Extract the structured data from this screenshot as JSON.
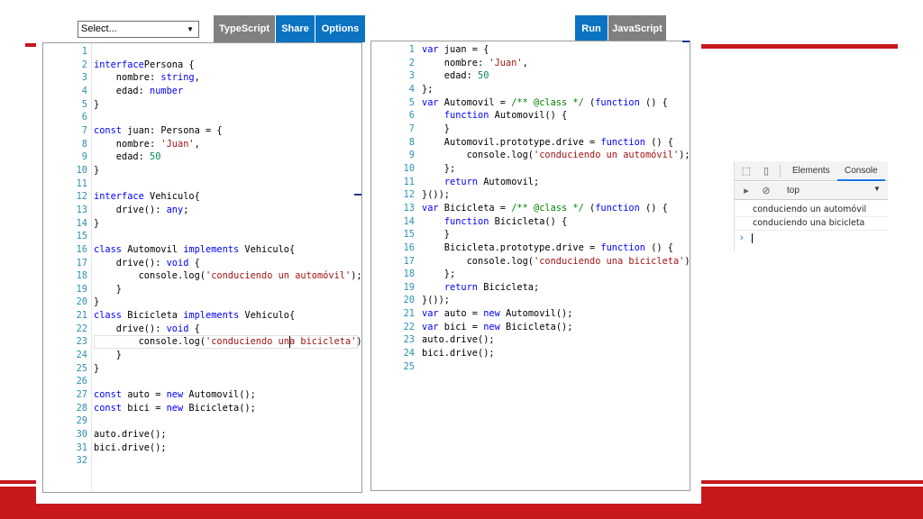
{
  "toolbar": {
    "select_value": "Select...",
    "typescript_label": "TypeScript",
    "share_label": "Share",
    "options_label": "Options",
    "run_label": "Run",
    "javascript_label": "JavaScript"
  },
  "colors": {
    "keyword": "#0000ff",
    "string": "#a31515",
    "number": "#09885a",
    "comment": "#008000",
    "line_number": "#2b91af",
    "accent_blue": "#0b73c2",
    "slide_red": "#c8171d"
  },
  "ts_code": [
    [],
    [
      [
        "kw",
        "interface"
      ],
      [
        "",
        "Persona {"
      ]
    ],
    [
      [
        "",
        "    nombre: "
      ],
      [
        "kw",
        "string"
      ],
      [
        "",
        ","
      ]
    ],
    [
      [
        "",
        "    edad: "
      ],
      [
        "kw",
        "number"
      ]
    ],
    [
      [
        "",
        "}"
      ]
    ],
    [],
    [
      [
        "kw",
        "const"
      ],
      [
        "",
        " juan: Persona = {"
      ]
    ],
    [
      [
        "",
        "    nombre: "
      ],
      [
        "st",
        "'Juan'"
      ],
      [
        "",
        ","
      ]
    ],
    [
      [
        "",
        "    edad: "
      ],
      [
        "nm",
        "50"
      ]
    ],
    [
      [
        "",
        "}"
      ]
    ],
    [],
    [
      [
        "kw",
        "interface"
      ],
      [
        "",
        " Vehiculo{"
      ]
    ],
    [
      [
        "",
        "    drive(): "
      ],
      [
        "kw",
        "any"
      ],
      [
        "",
        ";"
      ]
    ],
    [
      [
        "",
        "}"
      ]
    ],
    [],
    [
      [
        "kw",
        "class"
      ],
      [
        "",
        " Automovil "
      ],
      [
        "kw",
        "implements"
      ],
      [
        "",
        " Vehiculo{"
      ]
    ],
    [
      [
        "",
        "    drive(): "
      ],
      [
        "kw",
        "void"
      ],
      [
        "",
        " {"
      ]
    ],
    [
      [
        "",
        "        console.log("
      ],
      [
        "st",
        "'conduciendo un automóvil'"
      ],
      [
        "",
        ");"
      ]
    ],
    [
      [
        "",
        "    }"
      ]
    ],
    [
      [
        "",
        "}"
      ]
    ],
    [
      [
        "kw",
        "class"
      ],
      [
        "",
        " Bicicleta "
      ],
      [
        "kw",
        "implements"
      ],
      [
        "",
        " Vehiculo{"
      ]
    ],
    [
      [
        "",
        "    drive(): "
      ],
      [
        "kw",
        "void"
      ],
      [
        "",
        " {"
      ]
    ],
    [
      [
        "",
        "        console.log("
      ],
      [
        "st",
        "'conduciendo una bicicleta'"
      ],
      [
        "",
        ");"
      ]
    ],
    [
      [
        "",
        "    }"
      ]
    ],
    [
      [
        "",
        "}"
      ]
    ],
    [],
    [
      [
        "kw",
        "const"
      ],
      [
        "",
        " auto = "
      ],
      [
        "kw",
        "new"
      ],
      [
        "",
        " Automovil();"
      ]
    ],
    [
      [
        "kw",
        "const"
      ],
      [
        "",
        " bici = "
      ],
      [
        "kw",
        "new"
      ],
      [
        "",
        " Bicicleta();"
      ]
    ],
    [],
    [
      [
        "",
        "auto.drive();"
      ]
    ],
    [
      [
        "",
        "bici.drive();"
      ]
    ],
    []
  ],
  "js_code": [
    [
      [
        "kw",
        "var"
      ],
      [
        "",
        " juan = {"
      ]
    ],
    [
      [
        "",
        "    nombre: "
      ],
      [
        "st",
        "'Juan'"
      ],
      [
        "",
        ","
      ]
    ],
    [
      [
        "",
        "    edad: "
      ],
      [
        "nm",
        "50"
      ]
    ],
    [
      [
        "",
        "};"
      ]
    ],
    [
      [
        "kw",
        "var"
      ],
      [
        "",
        " Automovil = "
      ],
      [
        "cm",
        "/** @class */"
      ],
      [
        "",
        " ("
      ],
      [
        "kw",
        "function"
      ],
      [
        "",
        " () {"
      ]
    ],
    [
      [
        "",
        "    "
      ],
      [
        "kw",
        "function"
      ],
      [
        "",
        " Automovil() {"
      ]
    ],
    [
      [
        "",
        "    }"
      ]
    ],
    [
      [
        "",
        "    Automovil.prototype.drive = "
      ],
      [
        "kw",
        "function"
      ],
      [
        "",
        " () {"
      ]
    ],
    [
      [
        "",
        "        console.log("
      ],
      [
        "st",
        "'conduciendo un automóvil'"
      ],
      [
        "",
        ");"
      ]
    ],
    [
      [
        "",
        "    };"
      ]
    ],
    [
      [
        "",
        "    "
      ],
      [
        "kw",
        "return"
      ],
      [
        "",
        " Automovil;"
      ]
    ],
    [
      [
        "",
        "}());"
      ]
    ],
    [
      [
        "kw",
        "var"
      ],
      [
        "",
        " Bicicleta = "
      ],
      [
        "cm",
        "/** @class */"
      ],
      [
        "",
        " ("
      ],
      [
        "kw",
        "function"
      ],
      [
        "",
        " () {"
      ]
    ],
    [
      [
        "",
        "    "
      ],
      [
        "kw",
        "function"
      ],
      [
        "",
        " Bicicleta() {"
      ]
    ],
    [
      [
        "",
        "    }"
      ]
    ],
    [
      [
        "",
        "    Bicicleta.prototype.drive = "
      ],
      [
        "kw",
        "function"
      ],
      [
        "",
        " () {"
      ]
    ],
    [
      [
        "",
        "        console.log("
      ],
      [
        "st",
        "'conduciendo una bicicleta'"
      ],
      [
        "",
        ");"
      ]
    ],
    [
      [
        "",
        "    };"
      ]
    ],
    [
      [
        "",
        "    "
      ],
      [
        "kw",
        "return"
      ],
      [
        "",
        " Bicicleta;"
      ]
    ],
    [
      [
        "",
        "}());"
      ]
    ],
    [
      [
        "kw",
        "var"
      ],
      [
        "",
        " auto = "
      ],
      [
        "kw",
        "new"
      ],
      [
        "",
        " Automovil();"
      ]
    ],
    [
      [
        "kw",
        "var"
      ],
      [
        "",
        " bici = "
      ],
      [
        "kw",
        "new"
      ],
      [
        "",
        " Bicicleta();"
      ]
    ],
    [
      [
        "",
        "auto.drive();"
      ]
    ],
    [
      [
        "",
        "bici.drive();"
      ]
    ],
    []
  ],
  "devtools": {
    "tab_elements": "Elements",
    "tab_console": "Console",
    "context": "top",
    "messages": [
      "conduciendo un automóvil",
      "conduciendo una bicicleta"
    ],
    "prompt": "›"
  }
}
